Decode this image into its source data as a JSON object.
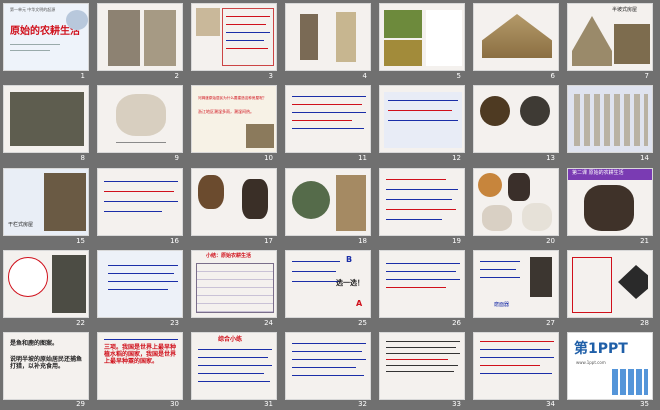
{
  "colors": {
    "background": "#707070",
    "slide": "#f4f1ee",
    "title_red": "#d0101b",
    "text_blue": "#1a2ea8",
    "banner_purple": "#7a3bb3"
  },
  "slides": [
    {
      "n": "1",
      "title": "原始的农耕生活",
      "subtitle": "第一单元 中华文明的起源"
    },
    {
      "n": "2"
    },
    {
      "n": "3"
    },
    {
      "n": "4"
    },
    {
      "n": "5"
    },
    {
      "n": "6"
    },
    {
      "n": "7",
      "caption": "半坡式房屋"
    },
    {
      "n": "8"
    },
    {
      "n": "9"
    },
    {
      "n": "10",
      "q1": "河姆渡原始居民为什么要建造这种房屋呢？",
      "q2": "浙江地区潮湿多雨，潮湿闷热。"
    },
    {
      "n": "11"
    },
    {
      "n": "12"
    },
    {
      "n": "13"
    },
    {
      "n": "14"
    },
    {
      "n": "15",
      "caption": "干栏式房屋"
    },
    {
      "n": "16"
    },
    {
      "n": "17"
    },
    {
      "n": "18"
    },
    {
      "n": "19"
    },
    {
      "n": "20"
    },
    {
      "n": "21",
      "banner": "第二课 原始的农耕生活"
    },
    {
      "n": "22"
    },
    {
      "n": "23"
    },
    {
      "n": "24",
      "heading": "小结：原始农耕生活"
    },
    {
      "n": "25",
      "label_b": "B",
      "answer": "选一选！",
      "label_a": "A"
    },
    {
      "n": "26"
    },
    {
      "n": "27",
      "caption": "磨面器"
    },
    {
      "n": "28"
    },
    {
      "n": "29",
      "line1": "是鱼和鹿的图案。",
      "line2": "说明半坡的原始居民还捕鱼打猎，以补充食用。"
    },
    {
      "n": "30",
      "title": "三项。我国是世界上最早种植水稻的国家，我国是世界上最早种粟的国家。"
    },
    {
      "n": "31",
      "title": "综合小练"
    },
    {
      "n": "32"
    },
    {
      "n": "33"
    },
    {
      "n": "34"
    },
    {
      "n": "35",
      "logo": "第1PPT",
      "logo_sub": "www.1ppt.com"
    }
  ]
}
